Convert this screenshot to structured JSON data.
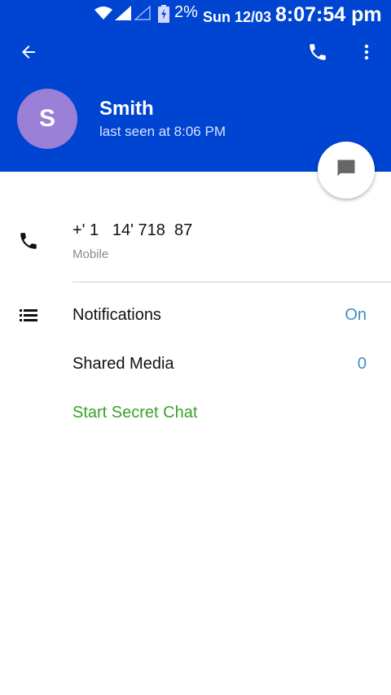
{
  "status_bar": {
    "battery_percent": "2%",
    "date": "Sun 12/03",
    "time": "8:07:54 pm"
  },
  "header": {
    "avatar_letter": "S",
    "name": "Smith",
    "last_seen": "last seen at 8:06 PM",
    "background_color": "#0044d2"
  },
  "contact": {
    "phone_number": "+' 1   14' 718  87",
    "phone_type": "Mobile"
  },
  "settings": [
    {
      "label": "Notifications",
      "value": "On"
    },
    {
      "label": "Shared Media",
      "value": "0"
    }
  ],
  "secret_chat_label": "Start Secret Chat",
  "icons": {
    "back": "arrow-back-icon",
    "call": "phone-icon",
    "menu": "more-vert-icon",
    "fab": "message-icon",
    "contact_phone": "phone-icon",
    "settings": "list-icon"
  }
}
